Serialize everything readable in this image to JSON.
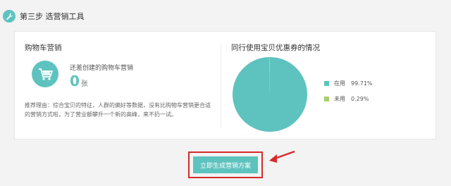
{
  "step": {
    "title": "第三步 选营销工具",
    "icon": "wrench-icon"
  },
  "cart_section": {
    "title": "购物车营销",
    "subtitle": "还差创建的购物车营销",
    "count": "0",
    "unit": "张",
    "icon": "cart-icon",
    "reason_label": "推荐理由：",
    "reason_text": "综合宝贝的特征，人群的偏好等数据，没有比购物车营销更合适的营销方式啦，为了营业额攀升一个新的高峰，来不扔一试。"
  },
  "coupon_section": {
    "title": "同行使用宝贝优惠券的情况",
    "legend": [
      {
        "label": "在用",
        "percent": "99.71%",
        "color": "#5ec3bf"
      },
      {
        "label": "未用",
        "percent": "0.29%",
        "color": "#a9cf6b"
      }
    ]
  },
  "chart_data": {
    "type": "pie",
    "categories": [
      "在用",
      "未用"
    ],
    "values": [
      99.71,
      0.29
    ],
    "colors": [
      "#5ec3bf",
      "#a9cf6b"
    ]
  },
  "cta": {
    "label": "立即生成营销方案"
  },
  "colors": {
    "accent": "#5ec3bf",
    "highlight": "#d52b2b"
  }
}
